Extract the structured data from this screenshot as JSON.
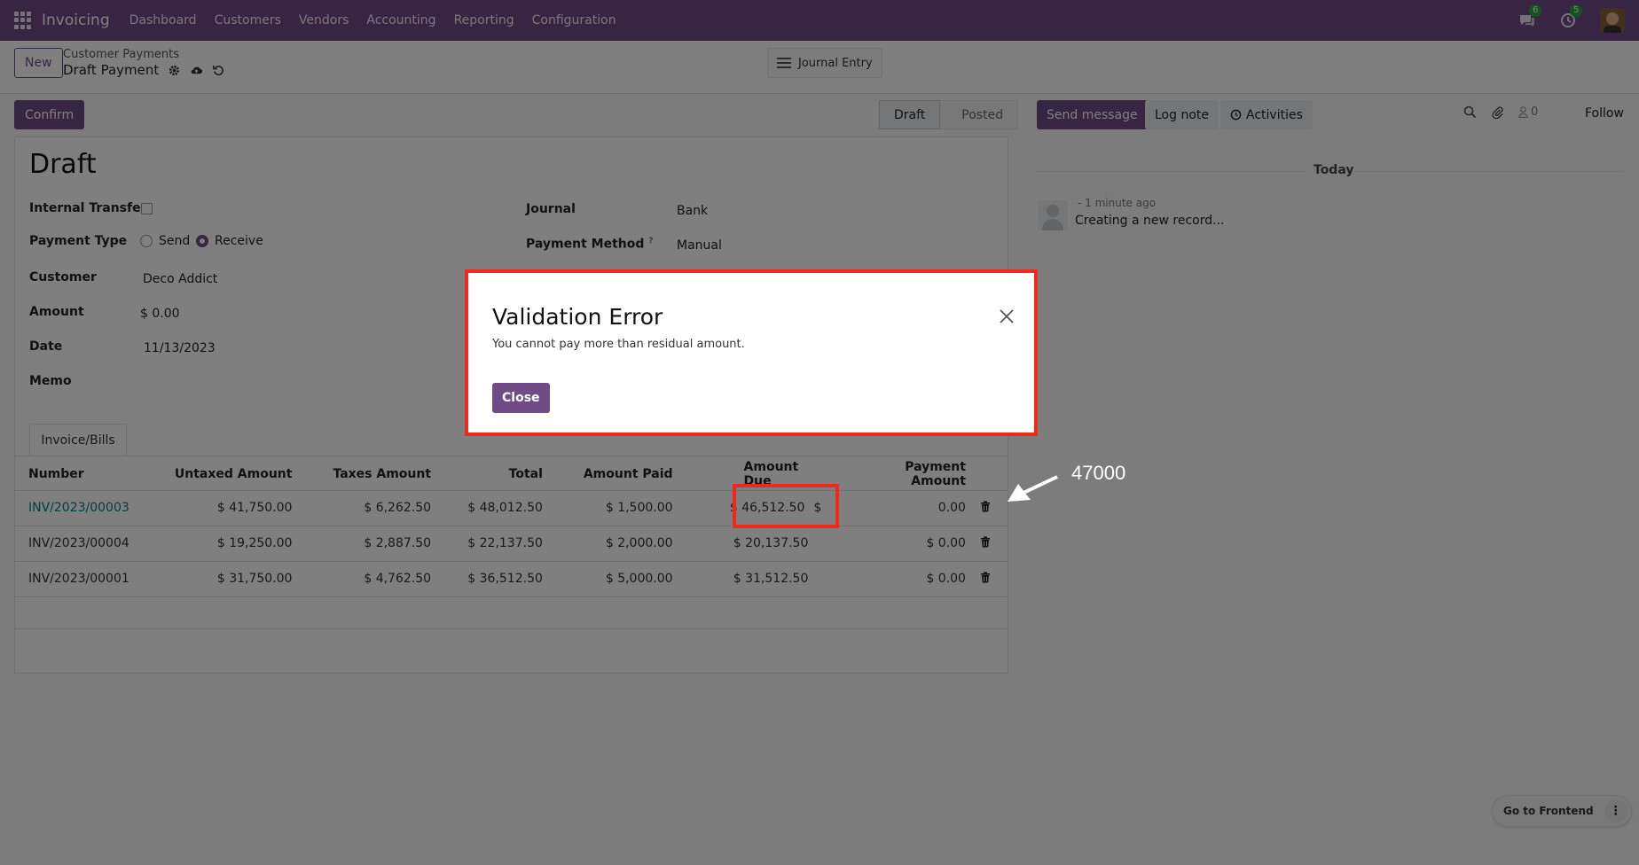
{
  "navbar": {
    "brand": "Invoicing",
    "menu": [
      "Dashboard",
      "Customers",
      "Vendors",
      "Accounting",
      "Reporting",
      "Configuration"
    ],
    "messages_badge": "6",
    "activities_badge": "5"
  },
  "control_panel": {
    "new_label": "New",
    "breadcrumb_parent": "Customer Payments",
    "breadcrumb_current": "Draft Payment",
    "journal_entry_label": "Journal Entry"
  },
  "status": {
    "confirm_label": "Confirm",
    "stages": [
      "Draft",
      "Posted"
    ],
    "active_stage": "Draft"
  },
  "form": {
    "title": "Draft",
    "internal_transfer_label": "Internal Transfer",
    "internal_transfer_checked": false,
    "payment_type_label": "Payment Type",
    "payment_type_options": [
      "Send",
      "Receive"
    ],
    "payment_type_selected": "Receive",
    "customer_label": "Customer",
    "customer_value": "Deco Addict",
    "amount_label": "Amount",
    "amount_value": "$ 0.00",
    "date_label": "Date",
    "date_value": "11/13/2023",
    "memo_label": "Memo",
    "journal_label": "Journal",
    "journal_value": "Bank",
    "payment_method_label": "Payment Method",
    "payment_method_help": "?",
    "payment_method_value": "Manual",
    "tab_label": "Invoice/Bills"
  },
  "lines": {
    "headers": [
      "Number",
      "Untaxed Amount",
      "Taxes Amount",
      "Total",
      "Amount Paid",
      "Amount Due",
      "Payment Amount"
    ],
    "rows": [
      {
        "number": "INV/2023/00003",
        "untaxed": "$ 41,750.00",
        "taxes": "$ 6,262.50",
        "total": "$ 48,012.50",
        "paid": "$ 1,500.00",
        "due": "$ 46,512.50",
        "due_suffix": "$",
        "payment": "0.00"
      },
      {
        "number": "INV/2023/00004",
        "untaxed": "$ 19,250.00",
        "taxes": "$ 2,887.50",
        "total": "$ 22,137.50",
        "paid": "$ 2,000.00",
        "due": "$ 20,137.50",
        "due_suffix": "",
        "payment": "$ 0.00"
      },
      {
        "number": "INV/2023/00001",
        "untaxed": "$ 31,750.00",
        "taxes": "$ 4,762.50",
        "total": "$ 36,512.50",
        "paid": "$ 5,000.00",
        "due": "$ 31,512.50",
        "due_suffix": "",
        "payment": "$ 0.00"
      }
    ]
  },
  "chatter": {
    "send_message": "Send message",
    "log_note": "Log note",
    "activities": "Activities",
    "followers_count": "0",
    "follow": "Follow",
    "today": "Today",
    "message_meta": "- 1 minute ago",
    "message_body": "Creating a new record..."
  },
  "go_frontend": "Go to Frontend",
  "dialog": {
    "title": "Validation Error",
    "message": "You cannot pay more than residual amount.",
    "close_label": "Close"
  },
  "annotation": {
    "text": "47000"
  },
  "colors": {
    "brand": "#714b87",
    "highlight": "#f0291b",
    "link": "#017e84"
  }
}
